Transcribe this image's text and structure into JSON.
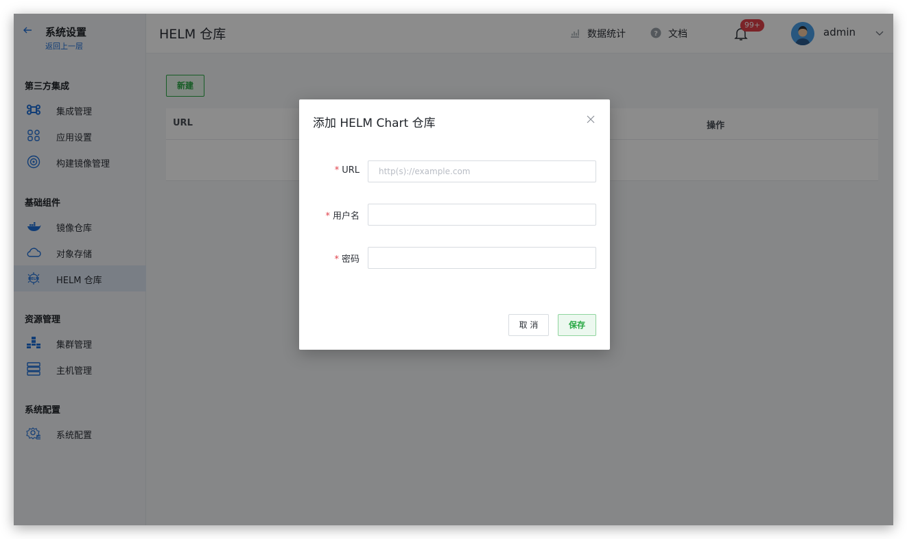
{
  "sidebar": {
    "title": "系统设置",
    "back_label": "返回上一层",
    "sections": [
      {
        "label": "第三方集成"
      },
      {
        "label": "基础组件"
      },
      {
        "label": "资源管理"
      },
      {
        "label": "系统配置"
      }
    ],
    "items": [
      {
        "label": "集成管理",
        "icon": "command-icon"
      },
      {
        "label": "应用设置",
        "icon": "apps-grid-icon"
      },
      {
        "label": "构建镜像管理",
        "icon": "disc-icon"
      },
      {
        "label": "镜像仓库",
        "icon": "docker-whale-icon"
      },
      {
        "label": "对象存储",
        "icon": "cloud-icon"
      },
      {
        "label": "HELM 仓库",
        "icon": "helm-icon",
        "active": true
      },
      {
        "label": "集群管理",
        "icon": "cluster-icon"
      },
      {
        "label": "主机管理",
        "icon": "server-icon"
      },
      {
        "label": "系统配置",
        "icon": "settings-gear-icon"
      }
    ]
  },
  "header": {
    "page_title": "HELM 仓库",
    "stats_label": "数据统计",
    "docs_label": "文档",
    "notification_badge": "99+",
    "username": "admin"
  },
  "main": {
    "new_button_label": "新建",
    "table": {
      "columns": [
        "URL",
        "操作"
      ]
    }
  },
  "dialog": {
    "title": "添加 HELM Chart 仓库",
    "required_mark": "*",
    "fields": {
      "url": {
        "label": "URL",
        "placeholder": "http(s)://example.com",
        "value": ""
      },
      "username": {
        "label": "用户名",
        "placeholder": "",
        "value": ""
      },
      "password": {
        "label": "密码",
        "placeholder": "",
        "value": ""
      }
    },
    "cancel_label": "取 消",
    "save_label": "保存"
  },
  "colors": {
    "primary": "#1f6fd8",
    "success": "#29a844",
    "danger": "#e0404a"
  }
}
